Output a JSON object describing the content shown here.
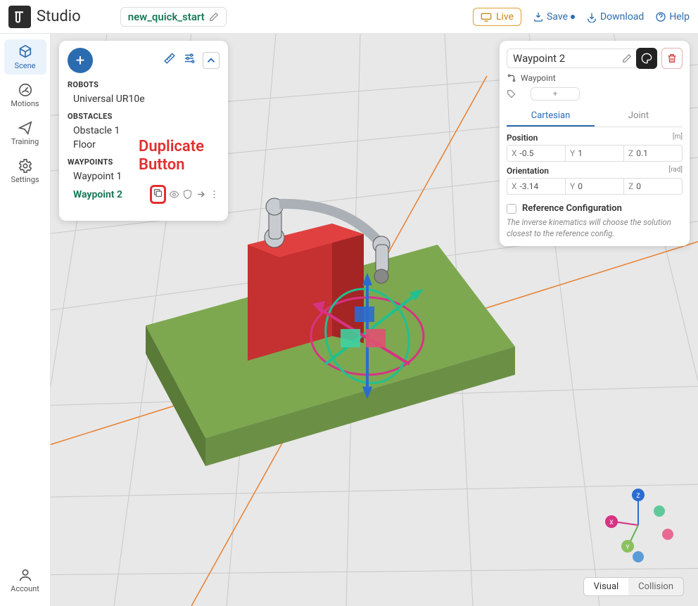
{
  "app_name": "Studio",
  "project_name": "new_quick_start",
  "header_actions": {
    "live": "Live",
    "save": "Save",
    "download": "Download",
    "help": "Help"
  },
  "sidebar": {
    "items": [
      {
        "id": "scene",
        "label": "Scene",
        "active": true
      },
      {
        "id": "motions",
        "label": "Motions",
        "active": false
      },
      {
        "id": "training",
        "label": "Training",
        "active": false
      },
      {
        "id": "settings",
        "label": "Settings",
        "active": false
      }
    ],
    "account": "Account"
  },
  "scene_tree": {
    "sections": [
      {
        "heading": "ROBOTS",
        "items": [
          {
            "name": "Universal UR10e"
          }
        ]
      },
      {
        "heading": "OBSTACLES",
        "items": [
          {
            "name": "Obstacle 1"
          },
          {
            "name": "Floor"
          }
        ]
      },
      {
        "heading": "WAYPOINTS",
        "items": [
          {
            "name": "Waypoint 1"
          },
          {
            "name": "Waypoint 2",
            "selected": true
          }
        ]
      }
    ]
  },
  "annotation": "Duplicate\nButton",
  "properties": {
    "title": "Waypoint 2",
    "type_label": "Waypoint",
    "tag_placeholder": "+",
    "tabs": {
      "cartesian": "Cartesian",
      "joint": "Joint",
      "active": "cartesian"
    },
    "position": {
      "label": "Position",
      "unit": "[m]",
      "x": "-0.5",
      "y": "1",
      "z": "0.1"
    },
    "orientation": {
      "label": "Orientation",
      "unit": "[rad]",
      "x": "-3.14",
      "y": "0",
      "z": "0"
    },
    "ref_cfg": {
      "label": "Reference Configuration",
      "desc": "The inverse kinematics will choose the solution closest to the reference config."
    }
  },
  "view_toggle": {
    "visual": "Visual",
    "collision": "Collision",
    "active": "visual"
  },
  "axis_labels": {
    "x": "X",
    "y": "Y",
    "z": "Z"
  }
}
